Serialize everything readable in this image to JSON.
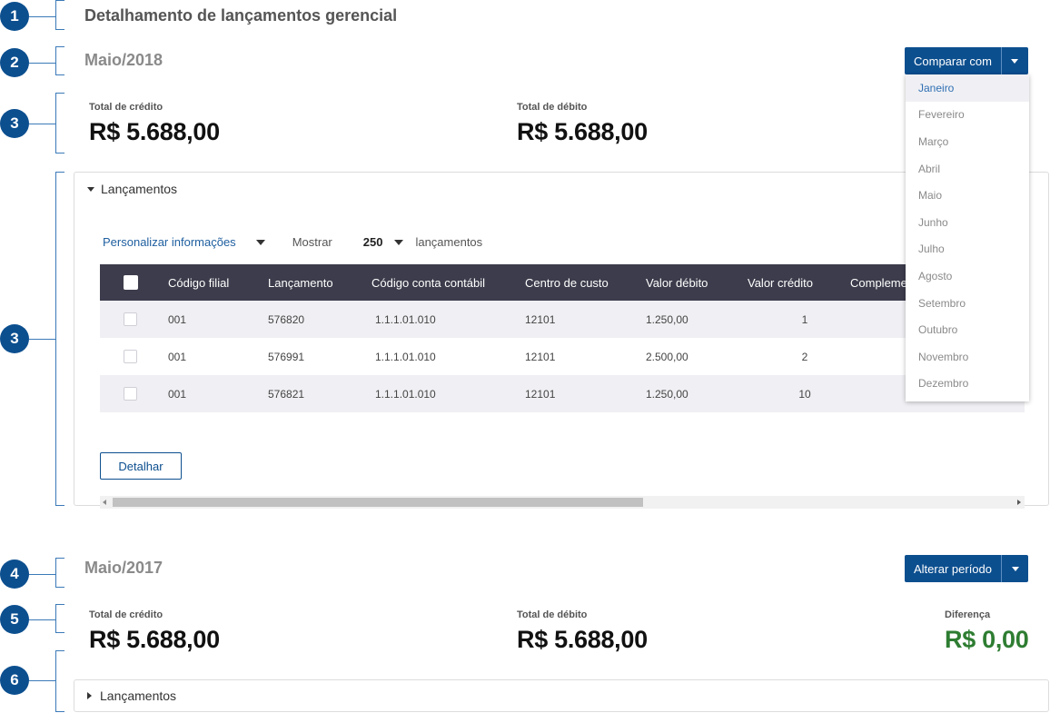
{
  "markers": [
    "1",
    "2",
    "3",
    "3",
    "4",
    "5",
    "6"
  ],
  "page_title": "Detalhamento de lançamentos gerencial",
  "current": {
    "period": "Maio/2018",
    "compare_button": "Comparar com",
    "credit_label": "Total de crédito",
    "credit_value": "R$ 5.688,00",
    "debit_label": "Total de débito",
    "debit_value": "R$ 5.688,00"
  },
  "compare_menu": {
    "options": [
      "Janeiro",
      "Fevereiro",
      "Março",
      "Abril",
      "Maio",
      "Junho",
      "Julho",
      "Agosto",
      "Setembro",
      "Outubro",
      "Novembro",
      "Dezembro"
    ],
    "active": "Janeiro"
  },
  "entries_panel": {
    "title": "Lançamentos",
    "customize": "Personalizar informações",
    "show_label": "Mostrar",
    "show_count": "250",
    "entries_label": "lançamentos",
    "columns": [
      "Código filial",
      "Lançamento",
      "Código conta contábil",
      "Centro de custo",
      "Valor débito",
      "Valor crédito",
      "Compleme"
    ],
    "rows": [
      [
        "001",
        "576820",
        "1.1.1.01.010",
        "12101",
        "1.250,00",
        "1"
      ],
      [
        "001",
        "576991",
        "1.1.1.01.010",
        "12101",
        "2.500,00",
        "2"
      ],
      [
        "001",
        "576821",
        "1.1.1.01.010",
        "12101",
        "1.250,00",
        "10"
      ]
    ],
    "detail_button": "Detalhar"
  },
  "comparison": {
    "period": "Maio/2017",
    "change_button": "Alterar período",
    "credit_label": "Total de crédito",
    "credit_value": "R$ 5.688,00",
    "debit_label": "Total de débito",
    "debit_value": "R$ 5.688,00",
    "difference_label": "Diferença",
    "difference_value": "R$ 0,00"
  },
  "comparison_panel": {
    "title": "Lançamentos"
  },
  "colors": {
    "primary": "#0c4f8f",
    "link": "#1f5fa0",
    "table_header": "#3c3c4c",
    "positive": "#2e7d32"
  }
}
